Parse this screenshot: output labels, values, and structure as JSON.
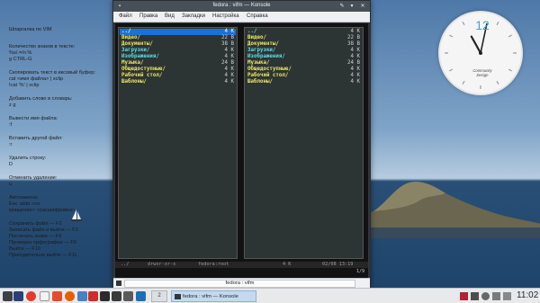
{
  "desktop": {
    "notes": {
      "title": "Шпаргалка по VIM",
      "items": [
        "Количество знаков в тексте:\n%s/.=/n %\ng CTRL-G",
        "Скопировать текст в иксовый буфер:\ncat <имя файла> | xclip\n!cat '%' | xclip",
        "Добавить слово в словарь:\nz g",
        "Вывести имя файла:\n:f",
        "Вставить другой файл:\n:r",
        "Удалить строку:\nD",
        "Отменить удаление:\nu",
        "Автозамена:\nEsc :abbr <со\nкращение> <расшифровка>",
        "Сохранить файл — F2\nЗаписать файл и выйти — F3\nПосчитать знаки — F4\nПроверка орфографии — F9\nВыйти — F10\nПринудительно выйти — F11"
      ]
    },
    "clock": {
      "hour_label": "12",
      "brand": "Community\nDesign",
      "time_hour": 11,
      "time_minute": 2
    }
  },
  "window": {
    "title": "fedora : vifm — Konsole",
    "menu": [
      "Файл",
      "Правка",
      "Вид",
      "Закладки",
      "Настройка",
      "Справка"
    ],
    "left_pane": [
      {
        "name": "../",
        "size": "4 K",
        "selected": true,
        "color": "cyan"
      },
      {
        "name": "Видео/",
        "size": "22 B",
        "color": "yellow"
      },
      {
        "name": "Документы/",
        "size": "38 B",
        "color": "yellow"
      },
      {
        "name": "Загрузки/",
        "size": "4 K",
        "color": "cyan"
      },
      {
        "name": "Изображения/",
        "size": "4 K",
        "color": "cyan"
      },
      {
        "name": "Музыка/",
        "size": "24 B",
        "color": "yellow"
      },
      {
        "name": "Общедоступные/",
        "size": "4 K",
        "color": "yellow"
      },
      {
        "name": "Рабочий стол/",
        "size": "4 K",
        "color": "yellow"
      },
      {
        "name": "Шаблоны/",
        "size": "4 K",
        "color": "yellow"
      }
    ],
    "right_pane": [
      {
        "name": "../",
        "size": "4 K",
        "color": "cyan"
      },
      {
        "name": "Видео/",
        "size": "22 B",
        "color": "yellow"
      },
      {
        "name": "Документы/",
        "size": "38 B",
        "color": "yellow"
      },
      {
        "name": "Загрузки/",
        "size": "4 K",
        "color": "cyan"
      },
      {
        "name": "Изображения/",
        "size": "4 K",
        "color": "cyan"
      },
      {
        "name": "Музыка/",
        "size": "24 B",
        "color": "yellow"
      },
      {
        "name": "Общедоступные/",
        "size": "4 K",
        "color": "yellow"
      },
      {
        "name": "Рабочий стол/",
        "size": "4 K",
        "color": "yellow"
      },
      {
        "name": "Шаблоны/",
        "size": "4 K",
        "color": "yellow"
      }
    ],
    "status": {
      "path": "../",
      "perms": "drwxr-xr-x",
      "owner": "fedora:root",
      "size": "4 K",
      "datetime": "02/08 13:19",
      "position": "1/9"
    },
    "tab_label": "fedora : vifm"
  },
  "taskbar": {
    "pager_label": "2",
    "task_label": "fedora : vifm — Konsole",
    "time": "11:02"
  },
  "colors": {
    "accent": "#1e6fd8",
    "dir_yellow": "#ece861",
    "dir_cyan": "#5ce0e8",
    "clock_accent": "#4a9fd6"
  }
}
